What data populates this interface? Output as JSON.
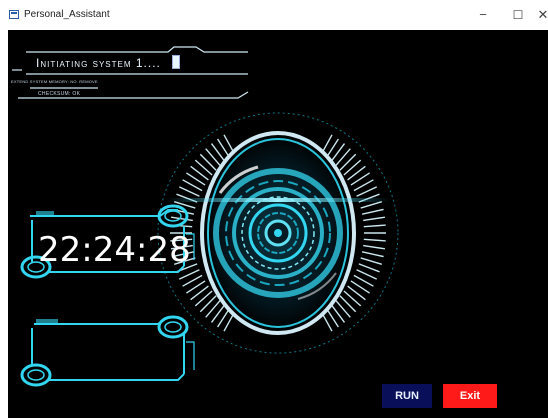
{
  "window": {
    "title": "Personal_Assistant",
    "controls": {
      "minimize": "−",
      "maximize": "☐",
      "close": "✕"
    }
  },
  "hud": {
    "status_text": "Initiating system 1....",
    "memory_text": "EXTEND SYSTEM MEMORY: NO. REMOVE",
    "checksum_text": "CHECKSUM: OK",
    "clock": "22:24:28"
  },
  "buttons": {
    "run": "RUN",
    "exit": "Exit"
  },
  "colors": {
    "accent": "#33d6f0",
    "accent_dim": "#1aa7c0",
    "background": "#000000",
    "run_button": "#0a0f5a",
    "exit_button": "#ff1a1a"
  }
}
